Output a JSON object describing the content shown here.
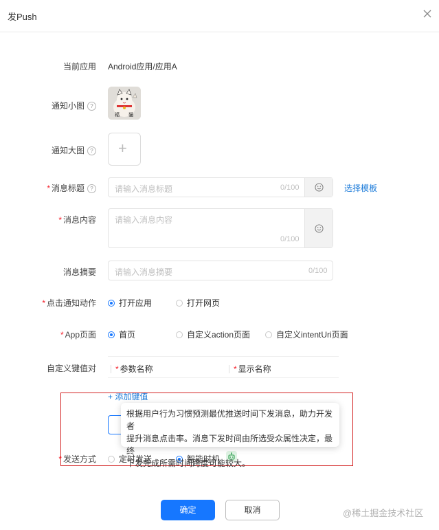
{
  "dialog": {
    "title": "发Push",
    "close_icon": "close-icon"
  },
  "form": {
    "current_app": {
      "label": "当前应用",
      "value": "Android应用/应用A"
    },
    "notify_small_image": {
      "label": "通知小图"
    },
    "notify_large_image": {
      "label": "通知大图"
    },
    "message_title": {
      "label": "消息标题",
      "placeholder": "请输入消息标题",
      "counter": "0/100",
      "template_link": "选择模板"
    },
    "message_content": {
      "label": "消息内容",
      "placeholder": "请输入消息内容",
      "counter": "0/100"
    },
    "message_summary": {
      "label": "消息摘要",
      "placeholder": "请输入消息摘要",
      "counter": "0/100"
    },
    "click_action": {
      "label": "点击通知动作",
      "options": [
        "打开应用",
        "打开网页"
      ],
      "selected": "打开应用"
    },
    "app_page": {
      "label": "App页面",
      "options": [
        "首页",
        "自定义action页面",
        "自定义intentUri页面"
      ],
      "selected": "首页"
    },
    "custom_kv": {
      "label": "自定义键值对",
      "columns": [
        "参数名称",
        "显示名称"
      ],
      "add_label": "+ 添加键值"
    },
    "send_mode": {
      "label": "发送方式",
      "options": [
        "定时发送",
        "智能时机"
      ],
      "selected": "智能时机"
    }
  },
  "tooltip": {
    "lines": [
      "根据用户行为习惯预测最优推送时间下发消息，助力开发者",
      "提升消息点击率。消息下发时间由所选受众属性决定，最终",
      "下发完成所需时间跨度可能较大。"
    ]
  },
  "footer": {
    "confirm_label": "确定",
    "cancel_label": "取消"
  },
  "watermark": "@稀土掘金技术社区",
  "colors": {
    "primary": "#1677ff",
    "required": "#f5222d",
    "link": "#1a7ad9",
    "highlight_border": "#d32121"
  }
}
